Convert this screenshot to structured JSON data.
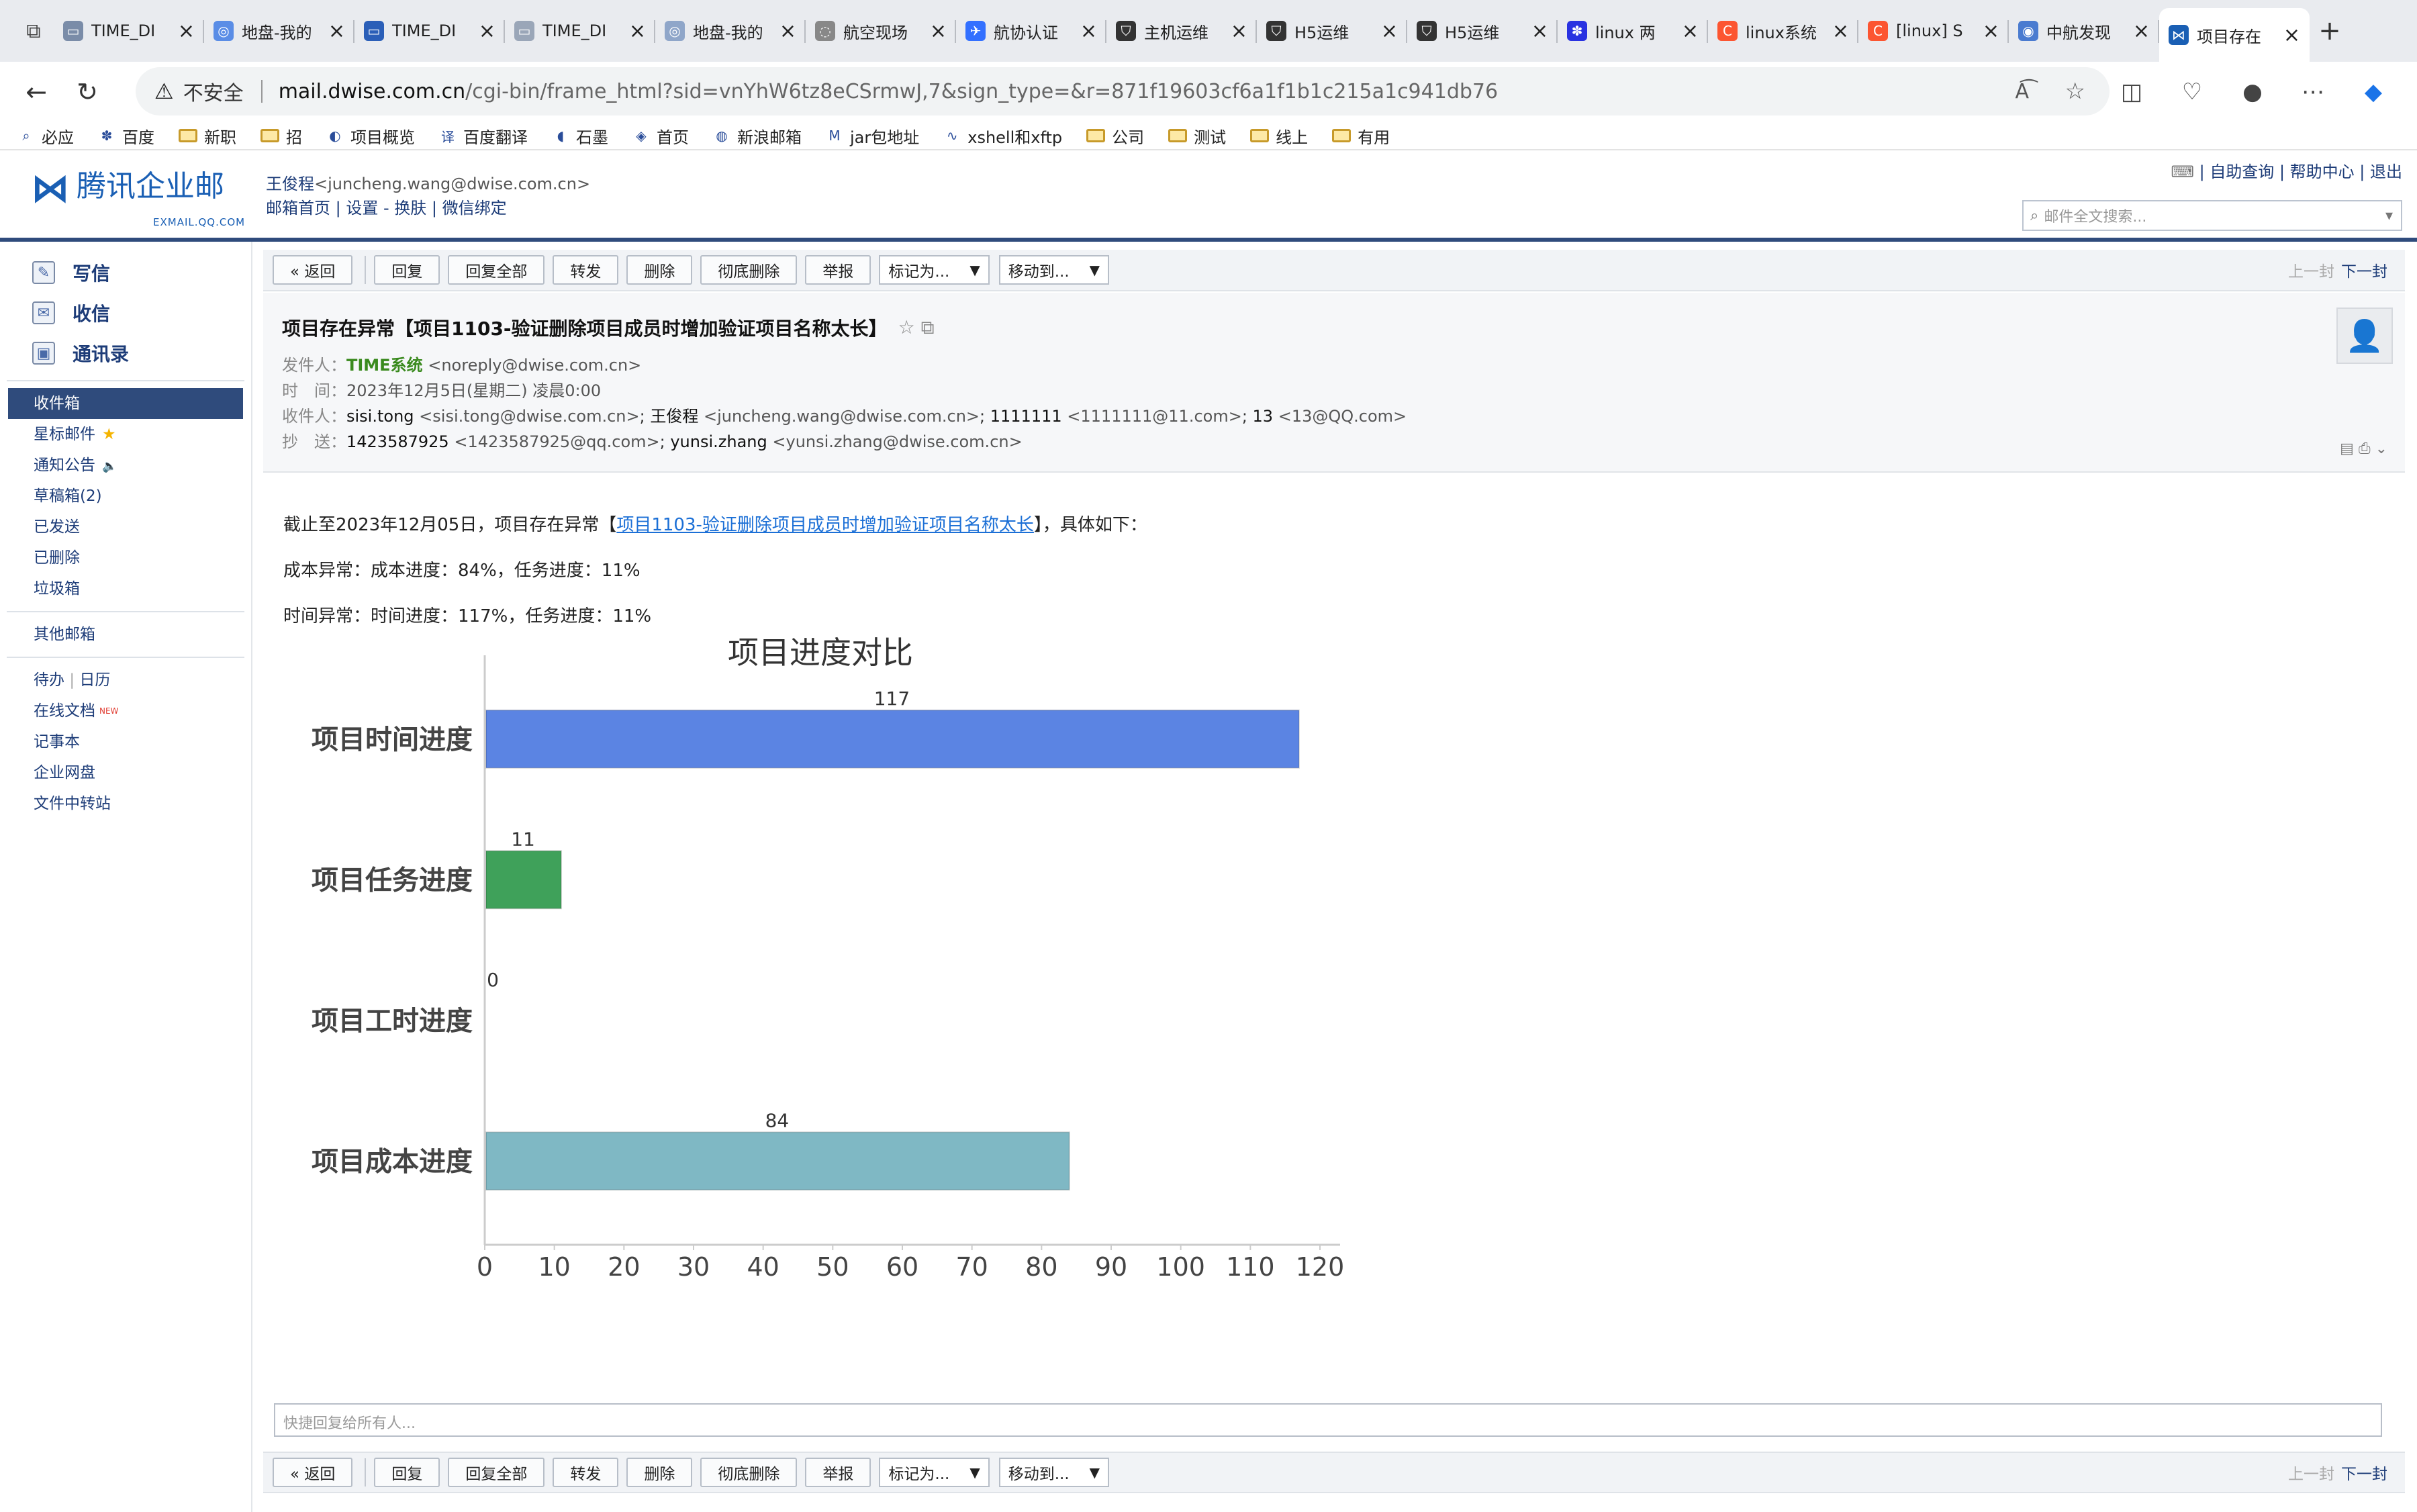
{
  "browser": {
    "tabs": [
      {
        "label": "TIME_DI",
        "icon": "dwise-icon",
        "color": "#7a8ca8"
      },
      {
        "label": "地盘-我的",
        "icon": "globe-icon",
        "color": "#5a8de6"
      },
      {
        "label": "TIME_DI",
        "icon": "dwise-icon",
        "color": "#2b5fb8"
      },
      {
        "label": "TIME_DI",
        "icon": "dwise-icon",
        "color": "#9aa6b8"
      },
      {
        "label": "地盘-我的",
        "icon": "globe-icon",
        "color": "#8fa6c9"
      },
      {
        "label": "航空现场",
        "icon": "loading-icon",
        "color": "#888888"
      },
      {
        "label": "航协认证",
        "icon": "feishu-icon",
        "color": "#3370ff"
      },
      {
        "label": "主机运维",
        "icon": "shield-icon",
        "color": "#333333"
      },
      {
        "label": "H5运维",
        "icon": "shield-icon",
        "color": "#333333"
      },
      {
        "label": "H5运维",
        "icon": "shield-icon",
        "color": "#333333"
      },
      {
        "label": "linux 两",
        "icon": "baidu-icon",
        "color": "#2932e1"
      },
      {
        "label": "linux系统",
        "icon": "csdn-icon",
        "color": "#fc5531"
      },
      {
        "label": "[linux] S",
        "icon": "csdn-icon",
        "color": "#fc5531"
      },
      {
        "label": "中航发现",
        "icon": "edge-icon",
        "color": "#4a7bd0"
      },
      {
        "label": "项目存在",
        "icon": "exmail-icon",
        "color": "#1a5fb4"
      }
    ],
    "insecure_label": "不安全",
    "url_host": "mail.dwise.com.cn",
    "url_path": "/cgi-bin/frame_html?sid=vnYhW6tz8eCSrmwJ,7&sign_type=&r=871f19603cf6a1f1b1c215a1c941db76",
    "bookmarks": [
      {
        "label": "必应",
        "icon": "search-icon"
      },
      {
        "label": "百度",
        "icon": "baidu-icon"
      },
      {
        "label": "新职",
        "icon": "folder-icon"
      },
      {
        "label": "招",
        "icon": "folder-icon"
      },
      {
        "label": "项目概览",
        "icon": "project-icon"
      },
      {
        "label": "百度翻译",
        "icon": "translate-icon"
      },
      {
        "label": "石墨",
        "icon": "shimo-icon"
      },
      {
        "label": "首页",
        "icon": "home-icon"
      },
      {
        "label": "新浪邮箱",
        "icon": "weibo-icon"
      },
      {
        "label": "jar包地址",
        "icon": "maven-icon"
      },
      {
        "label": "xshell和xftp",
        "icon": "xshell-icon"
      },
      {
        "label": "公司",
        "icon": "folder-icon"
      },
      {
        "label": "测试",
        "icon": "folder-icon"
      },
      {
        "label": "线上",
        "icon": "folder-icon"
      },
      {
        "label": "有用",
        "icon": "folder-icon"
      }
    ]
  },
  "mail": {
    "logo_text": "腾讯企业邮",
    "logo_sub": "EXMAIL.QQ.COM",
    "user_name": "王俊程",
    "user_email": "<juncheng.wang@dwise.com.cn>",
    "user_links": [
      "邮箱首页",
      "设置",
      "换肤",
      "微信绑定"
    ],
    "top_links": [
      "自助查询",
      "帮助中心",
      "退出"
    ],
    "search_placeholder": "邮件全文搜索...",
    "compose": [
      {
        "label": "写信",
        "icon": "compose-icon"
      },
      {
        "label": "收信",
        "icon": "inbox-icon"
      },
      {
        "label": "通讯录",
        "icon": "contacts-icon"
      }
    ],
    "folders": [
      "收件箱",
      "星标邮件",
      "通知公告",
      "草稿箱(2)",
      "已发送",
      "已删除",
      "垃圾箱"
    ],
    "other_mailbox": "其他邮箱",
    "tools": [
      "待办",
      "日历",
      "在线文档",
      "记事本",
      "企业网盘",
      "文件中转站"
    ],
    "new_badge": "NEW",
    "toolbar": {
      "back": "« 返回",
      "reply": "回复",
      "reply_all": "回复全部",
      "forward": "转发",
      "delete": "删除",
      "delete_perm": "彻底删除",
      "report": "举报",
      "mark_as": "标记为...",
      "move_to": "移动到...",
      "prev": "上一封",
      "next": "下一封"
    },
    "message": {
      "subject": "项目存在异常【项目1103-验证删除项目成员时增加验证项目名称太长】",
      "from_label": "发件人：",
      "from_name": "TIME系统",
      "from_addr": "<noreply@dwise.com.cn>",
      "time_label": "时　间：",
      "time": "2023年12月5日(星期二) 凌晨0:00",
      "to_label": "收件人：",
      "to": [
        {
          "name": "sisi.tong",
          "addr": "<sisi.tong@dwise.com.cn>"
        },
        {
          "name": "王俊程",
          "addr": "<juncheng.wang@dwise.com.cn>"
        },
        {
          "name": "1111111",
          "addr": "<1111111@11.com>"
        },
        {
          "name": "13",
          "addr": "<13@QQ.com>"
        }
      ],
      "cc_label": "抄　送：",
      "cc": [
        {
          "name": "1423587925",
          "addr": "<1423587925@qq.com>"
        },
        {
          "name": "yunsi.zhang",
          "addr": "<yunsi.zhang@dwise.com.cn>"
        }
      ],
      "body_prefix": "截止至2023年12月05日，项目存在异常【",
      "body_link": "项目1103-验证删除项目成员时增加验证项目名称太长",
      "body_suffix": "】，具体如下：",
      "cost_line": "成本异常：成本进度：84%，任务进度：11%",
      "time_line": "时间异常：时间进度：117%，任务进度：11%"
    },
    "reply_placeholder": "快捷回复给所有人..."
  },
  "chart_data": {
    "type": "bar",
    "orientation": "horizontal",
    "title": "项目进度对比",
    "categories": [
      "项目时间进度",
      "项目任务进度",
      "项目工时进度",
      "项目成本进度"
    ],
    "values": [
      117,
      11,
      0,
      84
    ],
    "colors": [
      "#5b84e3",
      "#3fa15a",
      "#6fa8c8",
      "#7fb8c4"
    ],
    "xlim": [
      0,
      120
    ],
    "xticks": [
      0,
      10,
      20,
      30,
      40,
      50,
      60,
      70,
      80,
      90,
      100,
      110,
      120
    ],
    "grid": false,
    "legend": "none"
  }
}
